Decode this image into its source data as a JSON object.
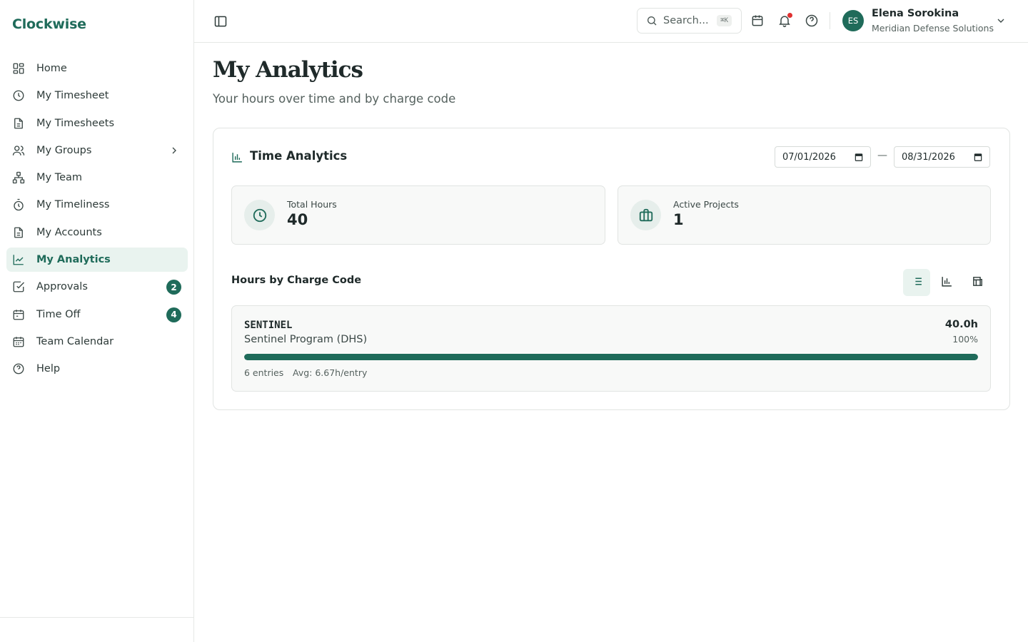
{
  "app": {
    "brand": "Clockwise"
  },
  "sidebar": {
    "items": [
      {
        "label": "Home",
        "icon": "dashboard-icon"
      },
      {
        "label": "My Timesheet",
        "icon": "clock-icon"
      },
      {
        "label": "My Timesheets",
        "icon": "document-icon"
      },
      {
        "label": "My Groups",
        "icon": "users-icon",
        "has_children": true
      },
      {
        "label": "My Team",
        "icon": "org-chart-icon"
      },
      {
        "label": "My Timeliness",
        "icon": "timer-icon"
      },
      {
        "label": "My Accounts",
        "icon": "document-icon"
      },
      {
        "label": "My Analytics",
        "icon": "line-chart-icon",
        "active": true
      },
      {
        "label": "Approvals",
        "icon": "check-square-icon",
        "badge": "2"
      },
      {
        "label": "Time Off",
        "icon": "calendar-icon",
        "badge": "4"
      },
      {
        "label": "Team Calendar",
        "icon": "calendar-grid-icon"
      },
      {
        "label": "Help",
        "icon": "help-circle-icon"
      }
    ]
  },
  "header": {
    "search_placeholder": "Search...",
    "search_shortcut": "⌘K",
    "user": {
      "initials": "ES",
      "name": "Elena Sorokina",
      "org": "Meridian Defense Solutions"
    }
  },
  "page": {
    "title": "My Analytics",
    "subtitle": "Your hours over time and by charge code"
  },
  "analytics": {
    "card_title": "Time Analytics",
    "date_from": "07/01/2026",
    "date_to": "08/31/2026",
    "date_separator": "—",
    "stats": {
      "total_hours_label": "Total Hours",
      "total_hours_value": "40",
      "active_projects_label": "Active Projects",
      "active_projects_value": "1"
    },
    "section_title": "Hours by Charge Code",
    "view_modes": [
      "list",
      "bar-chart",
      "table"
    ],
    "active_view": "list",
    "charge_codes": [
      {
        "code": "SENTINEL",
        "name": "Sentinel Program (DHS)",
        "hours": "40.0h",
        "percent": "100%",
        "share": 1.0,
        "entries": "6 entries",
        "avg": "Avg: 6.67h/entry"
      }
    ]
  },
  "colors": {
    "accent": "#1f6b5a",
    "accent_light": "#e9f3ef",
    "notification": "#e03131"
  }
}
